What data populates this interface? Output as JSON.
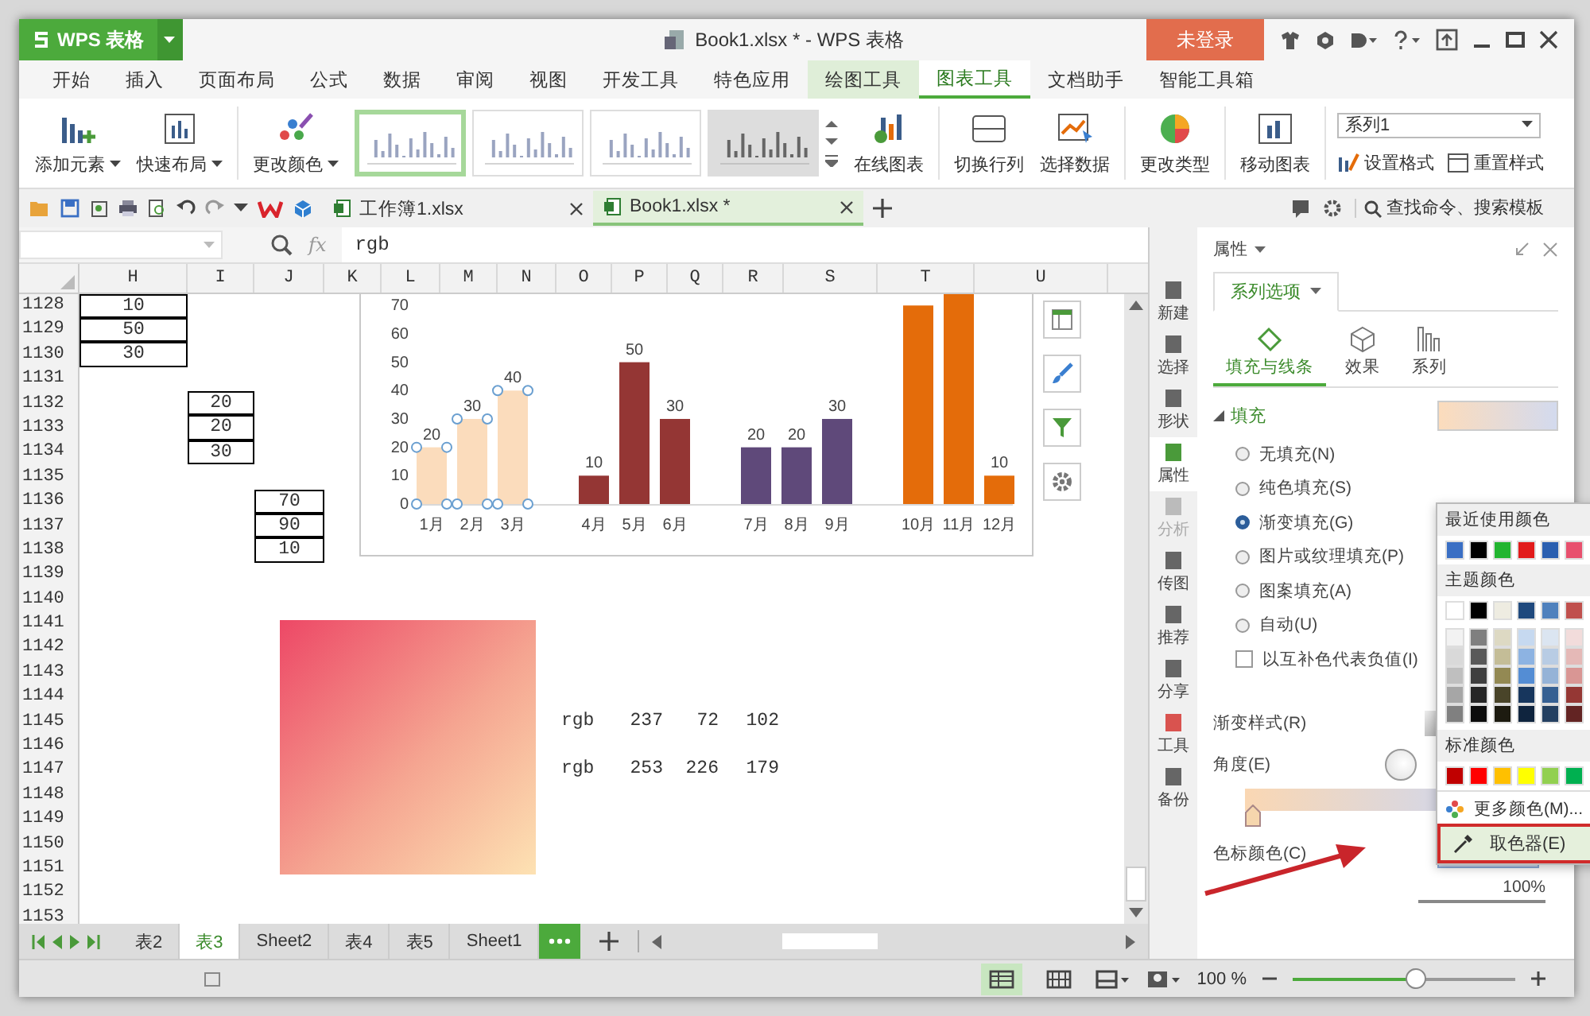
{
  "app": {
    "logo": "WPS 表格",
    "title": "Book1.xlsx * - WPS 表格",
    "login": "未登录"
  },
  "menu": [
    {
      "label": "开始",
      "selected": false,
      "context": false
    },
    {
      "label": "插入",
      "selected": false,
      "context": false
    },
    {
      "label": "页面布局",
      "selected": false,
      "context": false
    },
    {
      "label": "公式",
      "selected": false,
      "context": false
    },
    {
      "label": "数据",
      "selected": false,
      "context": false
    },
    {
      "label": "审阅",
      "selected": false,
      "context": false
    },
    {
      "label": "视图",
      "selected": false,
      "context": false
    },
    {
      "label": "开发工具",
      "selected": false,
      "context": false
    },
    {
      "label": "特色应用",
      "selected": false,
      "context": false
    },
    {
      "label": "绘图工具",
      "selected": false,
      "context": true
    },
    {
      "label": "图表工具",
      "selected": true,
      "context": true
    },
    {
      "label": "文档助手",
      "selected": false,
      "context": false
    },
    {
      "label": "智能工具箱",
      "selected": false,
      "context": false
    }
  ],
  "ribbon": {
    "add_element": "添加元素",
    "quick_layout": "快速布局",
    "change_color": "更改颜色",
    "styles": [
      {
        "selected": true
      },
      {
        "selected": false
      },
      {
        "selected": false
      },
      {
        "selected": false
      }
    ],
    "online_chart": "在线图表",
    "switch_row_col": "切换行列",
    "select_data": "选择数据",
    "change_type": "更改类型",
    "move_chart": "移动图表",
    "series_select": "系列1",
    "format": "设置格式",
    "reset_style": "重置样式"
  },
  "doc_tabs": [
    {
      "label": "工作簿1.xlsx",
      "selected": false
    },
    {
      "label": "Book1.xlsx *",
      "selected": true
    }
  ],
  "search": {
    "placeholder": "查找命令、搜索模板"
  },
  "formula": {
    "function_label": "fx",
    "value": "rgb"
  },
  "sheet": {
    "columns": [
      "H",
      "I",
      "J",
      "K",
      "L",
      "M",
      "N",
      "O",
      "P",
      "Q",
      "R",
      "S",
      "T",
      "U"
    ],
    "rows": [
      {
        "number": "1128",
        "cells": [
          {
            "value": "10",
            "kind": "boxed"
          }
        ]
      },
      {
        "number": "1129",
        "cells": [
          {
            "value": "50",
            "kind": "boxed"
          }
        ]
      },
      {
        "number": "1130",
        "cells": [
          {
            "value": "30",
            "kind": "boxed"
          }
        ]
      },
      {
        "number": "1131"
      },
      {
        "number": "1132",
        "cells": [
          {},
          {
            "value": "20",
            "kind": "boxed"
          }
        ]
      },
      {
        "number": "1133",
        "cells": [
          {},
          {
            "value": "20",
            "kind": "boxed"
          }
        ]
      },
      {
        "number": "1134",
        "cells": [
          {},
          {
            "value": "30",
            "kind": "boxed"
          }
        ]
      },
      {
        "number": "1135"
      },
      {
        "number": "1136",
        "cells": [
          {},
          {},
          {
            "value": "70",
            "kind": "boxed"
          }
        ]
      },
      {
        "number": "1137",
        "cells": [
          {},
          {},
          {
            "value": "90",
            "kind": "boxed"
          }
        ]
      },
      {
        "number": "1138",
        "cells": [
          {},
          {},
          {
            "value": "10",
            "kind": "boxed"
          }
        ]
      },
      {
        "number": "1139"
      },
      {
        "number": "1140"
      },
      {
        "number": "1141"
      },
      {
        "number": "1142"
      },
      {
        "number": "1143"
      },
      {
        "number": "1144"
      },
      {
        "number": "1145",
        "cells": [
          {},
          {},
          {},
          {},
          {},
          {},
          {},
          {
            "value": "rgb",
            "kind": "text"
          },
          {
            "value": "237",
            "kind": "number"
          },
          {
            "value": "72",
            "kind": "number"
          },
          {
            "value": "102",
            "kind": "number"
          }
        ]
      },
      {
        "number": "1146"
      },
      {
        "number": "1147",
        "cells": [
          {},
          {},
          {},
          {},
          {},
          {},
          {},
          {
            "value": "rgb",
            "kind": "text"
          },
          {
            "value": "253",
            "kind": "number"
          },
          {
            "value": "226",
            "kind": "number"
          },
          {
            "value": "179",
            "kind": "number"
          }
        ]
      },
      {
        "number": "1148"
      },
      {
        "number": "1149"
      },
      {
        "number": "1150"
      },
      {
        "number": "1151"
      },
      {
        "number": "1152"
      },
      {
        "number": "1153"
      }
    ],
    "chart": {
      "series_state": [
        {
          "selected": true
        },
        {
          "selected": false
        },
        {
          "selected": false
        },
        {
          "selected": false
        }
      ],
      "chart_data": {
        "type": "bar",
        "categories": [
          "1月",
          "2月",
          "3月",
          "4月",
          "5月",
          "6月",
          "7月",
          "8月",
          "9月",
          "10月",
          "11月",
          "12月"
        ],
        "series": [
          {
            "color": "#fbdcbc",
            "values": [
              20,
              30,
              40,
              null,
              null,
              null,
              null,
              null,
              null,
              null,
              null,
              null
            ]
          },
          {
            "color": "#943634",
            "values": [
              null,
              null,
              null,
              10,
              50,
              30,
              null,
              null,
              null,
              null,
              null,
              null
            ]
          },
          {
            "color": "#5f497a",
            "values": [
              null,
              null,
              null,
              null,
              null,
              null,
              20,
              20,
              30,
              null,
              null,
              null
            ]
          },
          {
            "color": "#e46c0a",
            "values": [
              null,
              null,
              null,
              null,
              null,
              null,
              null,
              null,
              null,
              70,
              74,
              10
            ]
          }
        ],
        "stacked": true,
        "ylim": [
          0,
          74
        ],
        "yticks": [
          0,
          10,
          20,
          30,
          40,
          50,
          60,
          70
        ],
        "value_labels": [
          "20",
          "30",
          "40",
          "10",
          "50",
          "30",
          "20",
          "20",
          "30",
          null,
          null,
          "10"
        ]
      }
    }
  },
  "sheet_tabs": [
    {
      "label": "表2",
      "selected": false
    },
    {
      "label": "表3",
      "selected": true
    },
    {
      "label": "Sheet2",
      "selected": false
    },
    {
      "label": "表4",
      "selected": false
    },
    {
      "label": "表5",
      "selected": false
    },
    {
      "label": "Sheet1",
      "selected": false
    }
  ],
  "side_strip": [
    {
      "label": "新建",
      "selected": false,
      "disabled": false
    },
    {
      "label": "选择",
      "selected": false,
      "disabled": false
    },
    {
      "label": "形状",
      "selected": false,
      "disabled": false
    },
    {
      "label": "属性",
      "selected": true,
      "disabled": false
    },
    {
      "label": "分析",
      "selected": false,
      "disabled": true
    },
    {
      "label": "传图",
      "selected": false,
      "disabled": false
    },
    {
      "label": "推荐",
      "selected": false,
      "disabled": false
    },
    {
      "label": "分享",
      "selected": false,
      "disabled": false
    },
    {
      "label": "工具",
      "selected": false,
      "disabled": false
    },
    {
      "label": "备份",
      "selected": false,
      "disabled": false
    }
  ],
  "panel": {
    "title": "属性",
    "tab": "系列选项",
    "subtabs": [
      {
        "label": "填充与线条",
        "selected": true
      },
      {
        "label": "效果",
        "selected": false
      },
      {
        "label": "系列",
        "selected": false
      }
    ],
    "section": "填充",
    "fill_options": [
      {
        "label": "无填充(N)",
        "selected": false
      },
      {
        "label": "纯色填充(S)",
        "selected": false
      },
      {
        "label": "渐变填充(G)",
        "selected": true
      },
      {
        "label": "图片或纹理填充(P)",
        "selected": false
      },
      {
        "label": "图案填充(A)",
        "selected": false
      },
      {
        "label": "自动(U)",
        "selected": false
      }
    ],
    "invert": {
      "label": "以互补色代表负值(I)",
      "checked": false
    },
    "gradient_style": "渐变样式(R)",
    "angle": "角度(E)",
    "stop_color": "色标颜色(C)",
    "position": {
      "value": "100%",
      "level": 1
    }
  },
  "color_popup": {
    "recent_title": "最近使用颜色",
    "recent": [
      {
        "color": "#3a6fc4"
      },
      {
        "color": "#000000"
      },
      {
        "color": "#22b530"
      },
      {
        "color": "#e21b1b"
      },
      {
        "color": "#2a5fb0"
      },
      {
        "color": "#e8506e"
      }
    ],
    "theme_title": "主题颜色",
    "theme": [
      {
        "color": "#ffffff"
      },
      {
        "color": "#000000"
      },
      {
        "color": "#eeece1"
      },
      {
        "color": "#1f497d"
      },
      {
        "color": "#4f81bd"
      },
      {
        "color": "#c0504d"
      }
    ],
    "shades": [
      [
        {
          "color": "#f2f2f2"
        },
        {
          "color": "#7f7f7f"
        },
        {
          "color": "#ddd9c3"
        },
        {
          "color": "#c6d9f0"
        },
        {
          "color": "#dbe5f1"
        },
        {
          "color": "#f2dcdb"
        }
      ],
      [
        {
          "color": "#d9d9d9"
        },
        {
          "color": "#595959"
        },
        {
          "color": "#c4bd97"
        },
        {
          "color": "#8db3e2"
        },
        {
          "color": "#b8cce4"
        },
        {
          "color": "#e5b9b7"
        }
      ],
      [
        {
          "color": "#bfbfbf"
        },
        {
          "color": "#3f3f3f"
        },
        {
          "color": "#938953"
        },
        {
          "color": "#548dd4"
        },
        {
          "color": "#95b3d7"
        },
        {
          "color": "#d99694"
        }
      ],
      [
        {
          "color": "#a6a6a6"
        },
        {
          "color": "#262626"
        },
        {
          "color": "#494429"
        },
        {
          "color": "#17365d"
        },
        {
          "color": "#366092"
        },
        {
          "color": "#953734"
        }
      ],
      [
        {
          "color": "#808080"
        },
        {
          "color": "#0d0d0d"
        },
        {
          "color": "#1d1b10"
        },
        {
          "color": "#0f243e"
        },
        {
          "color": "#244061"
        },
        {
          "color": "#632423"
        }
      ]
    ],
    "standard_title": "标准颜色",
    "standard": [
      {
        "color": "#c00000"
      },
      {
        "color": "#ff0000"
      },
      {
        "color": "#ffc000"
      },
      {
        "color": "#ffff00"
      },
      {
        "color": "#92d050"
      },
      {
        "color": "#00b050"
      }
    ],
    "more": "更多颜色(M)...",
    "picker": {
      "label": "取色器(E)",
      "highlighted": true
    }
  },
  "status": {
    "zoom": "100 %",
    "zoom_level": {
      "level": 0.56
    }
  }
}
